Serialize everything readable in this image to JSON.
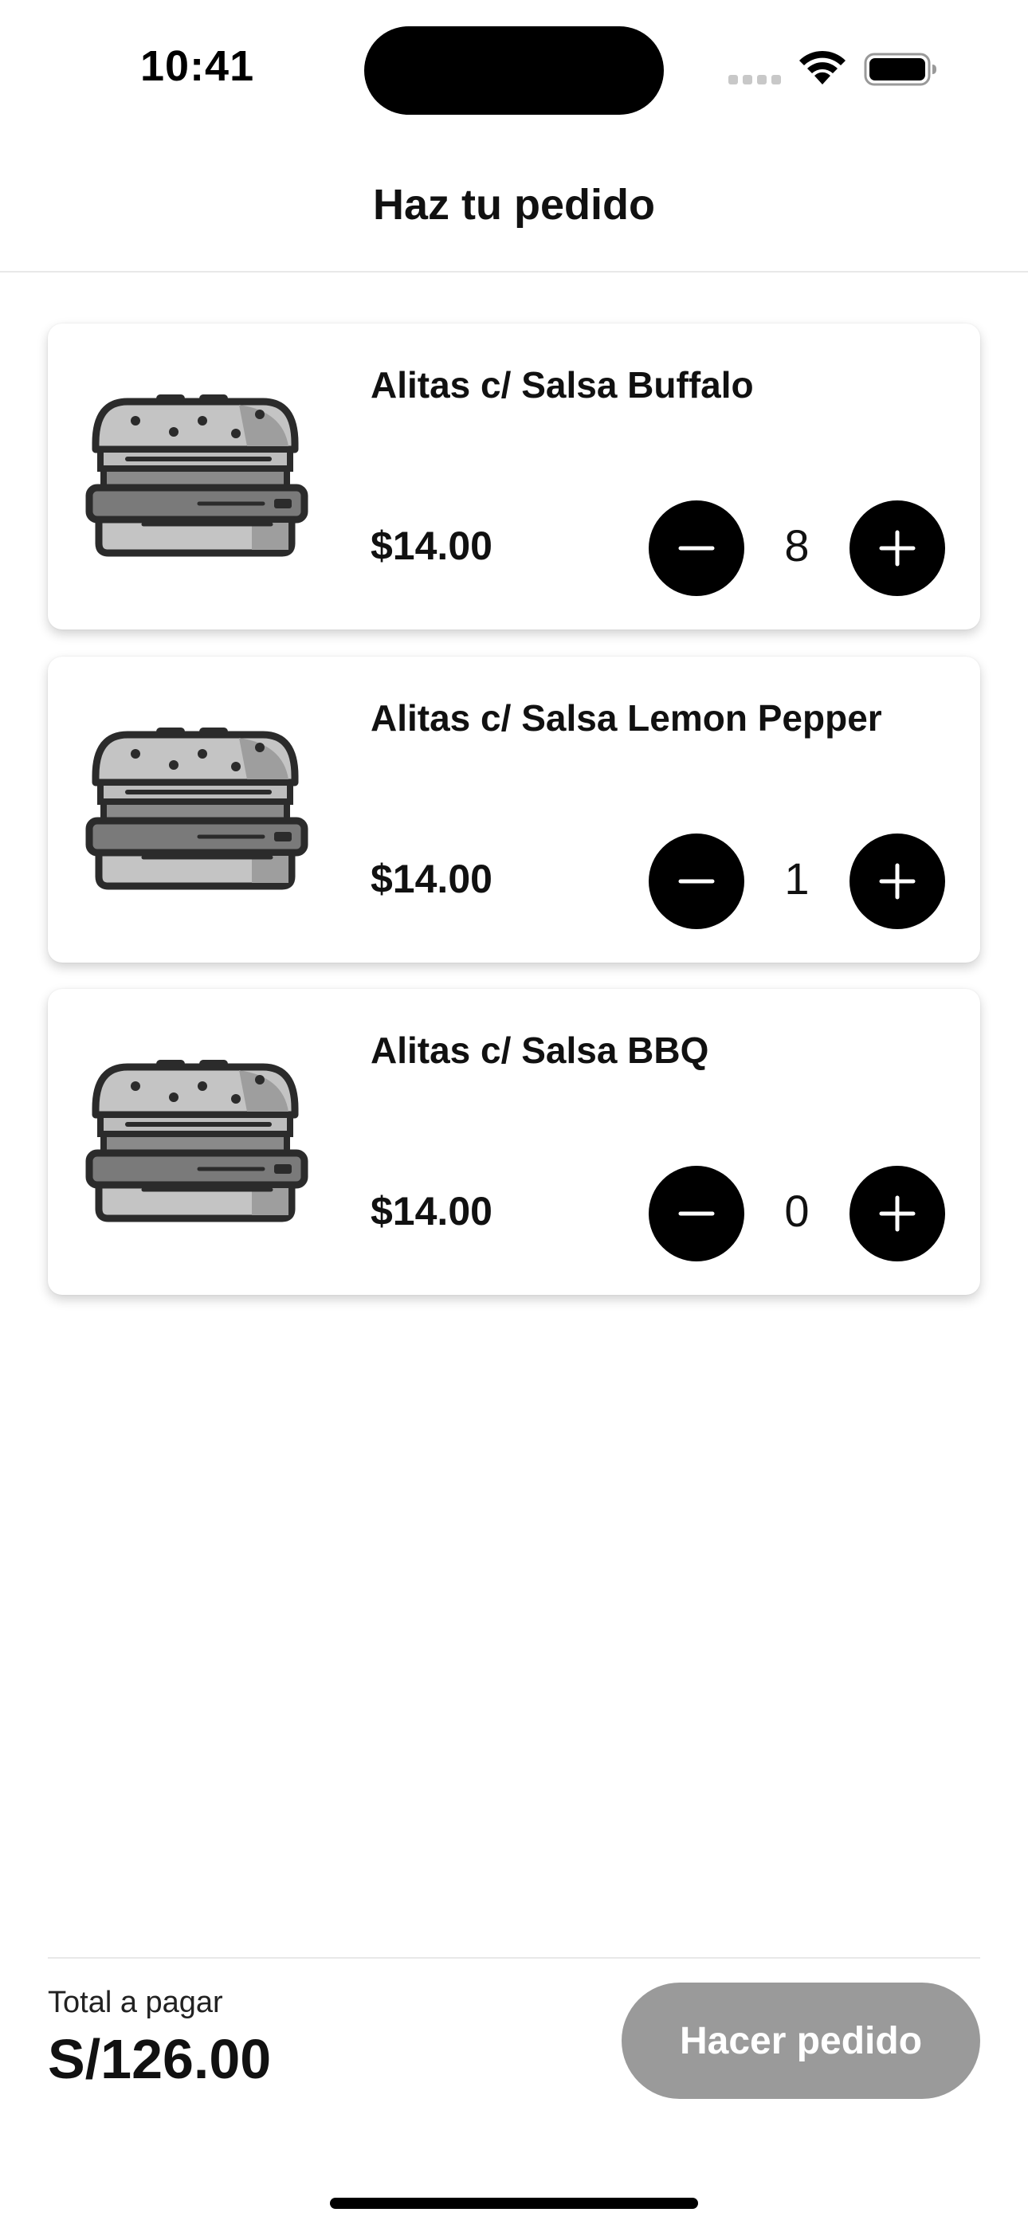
{
  "status_bar": {
    "time": "10:41"
  },
  "header": {
    "title": "Haz tu pedido"
  },
  "products": [
    {
      "name": "Alitas c/ Salsa Buffalo",
      "price": "$14.00",
      "quantity": "8",
      "image_icon": "burger-icon"
    },
    {
      "name": "Alitas c/ Salsa Lemon Pepper",
      "price": "$14.00",
      "quantity": "1",
      "image_icon": "burger-icon"
    },
    {
      "name": "Alitas c/ Salsa BBQ",
      "price": "$14.00",
      "quantity": "0",
      "image_icon": "burger-icon"
    }
  ],
  "footer": {
    "total_label": "Total a pagar",
    "total_value": "S/126.00",
    "order_button_label": "Hacer pedido"
  },
  "colors": {
    "primary": "#000000",
    "button_disabled": "#9a9a9a",
    "background": "#ffffff"
  }
}
